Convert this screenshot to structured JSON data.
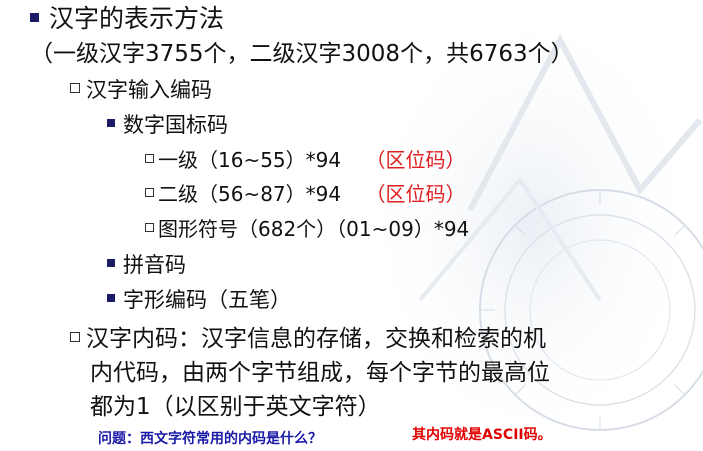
{
  "title": "汉字的表示方法",
  "subtitle": "（一级汉字3755个，二级汉字3008个，共6763个）",
  "input_code": {
    "label": "汉字输入编码",
    "guobiao": {
      "label": "数字国标码",
      "items": [
        {
          "text": "一级（16~55）*94",
          "note": "（区位码）"
        },
        {
          "text": "二级（56~87）*94",
          "note": "（区位码）"
        },
        {
          "text": "图形符号（682个）（01~09）*94",
          "note": ""
        }
      ]
    },
    "pinyin": "拼音码",
    "zixing": "字形编码（五笔）"
  },
  "internal_code": {
    "lines": [
      "汉字内码：汉字信息的存储，交换和检索的机",
      "内代码，由两个字节组成，每个字节的最高位",
      "都为1（以区别于英文字符）"
    ]
  },
  "qa": {
    "question": "问题：西文字符常用的内码是什么？",
    "answer": "其内码就是ASCII码。"
  },
  "colors": {
    "bullet": "#1c1c66",
    "highlight": "#e02020",
    "question": "#1a1aa8",
    "answer": "#e00000"
  }
}
